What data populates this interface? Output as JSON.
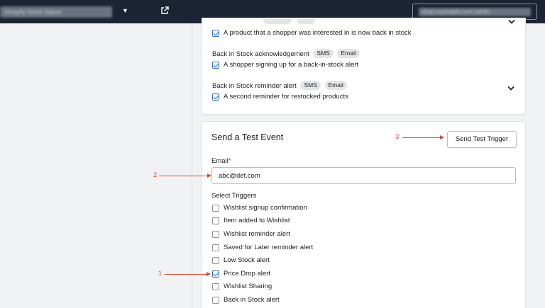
{
  "topbar": {
    "store_name": "Shopify Store Name",
    "account_label": "shop.myshopify.com admin"
  },
  "back_in_stock_group": {
    "rows": [
      {
        "checkbox_label": "A product that a shopper was interested in is now back in stock",
        "checked": true
      },
      {
        "title": "Back in Stock acknowledgement",
        "tags": [
          "SMS",
          "Email"
        ],
        "checkbox_label": "A shopper signing up for a back-in-stock alert",
        "checked": true
      },
      {
        "title": "Back in Stock reminder alert",
        "tags": [
          "SMS",
          "Email"
        ],
        "checkbox_label": "A second reminder for restocked products",
        "checked": true
      }
    ]
  },
  "test_event": {
    "title": "Send a Test Event",
    "send_button": "Send Test Trigger",
    "email_label": "Email",
    "email_required_mark": "*",
    "email_value": "abc@def.com",
    "triggers_label": "Select Triggers",
    "triggers": [
      {
        "label": "Wishlist signup confirmation",
        "checked": false
      },
      {
        "label": "Item added to Wishlist",
        "checked": false
      },
      {
        "label": "Wishlist reminder alert",
        "checked": false
      },
      {
        "label": "Saved for Later reminder alert",
        "checked": false
      },
      {
        "label": "Low Stock alert",
        "checked": false
      },
      {
        "label": "Price Drop alert",
        "checked": true
      },
      {
        "label": "Wishlist Sharing",
        "checked": false
      },
      {
        "label": "Back in Stock alert",
        "checked": false
      }
    ]
  },
  "annotations": [
    {
      "number": "1",
      "target": "Price Drop alert checkbox"
    },
    {
      "number": "2",
      "target": "Email input"
    },
    {
      "number": "3",
      "target": "Send Test Trigger button"
    }
  ],
  "colors": {
    "topbar": "#1c2433",
    "accent_check": "#2c6ecb",
    "annotation": "#d84a38",
    "required": "#d72c0d"
  },
  "icons": {
    "external_link": "external-link-icon",
    "dropdown": "caret-down-icon",
    "expand": "chevron-down-icon"
  }
}
